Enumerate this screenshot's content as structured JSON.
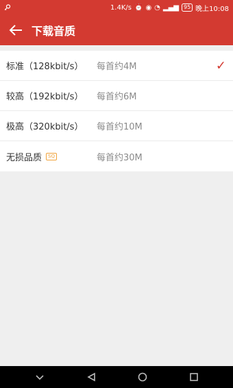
{
  "status_bar": {
    "left_icon": "key-icon",
    "speed": "1.4K/s",
    "battery": "95",
    "time": "晚上10:08"
  },
  "app_bar": {
    "title": "下载音质",
    "back_icon": "arrow-left-icon"
  },
  "quality_options": [
    {
      "label": "标准（128kbit/s）",
      "size": "每首约4M",
      "selected": true
    },
    {
      "label": "较高（192kbit/s）",
      "size": "每首约6M",
      "selected": false
    },
    {
      "label": "极高（320kbit/s）",
      "size": "每首约10M",
      "selected": false
    },
    {
      "label": "无损品质",
      "size": "每首约30M",
      "selected": false,
      "badge": "SQ"
    }
  ],
  "colors": {
    "accent": "#d33a31",
    "background": "#efefef",
    "text_primary": "#333333",
    "text_secondary": "#8a8a8a"
  }
}
